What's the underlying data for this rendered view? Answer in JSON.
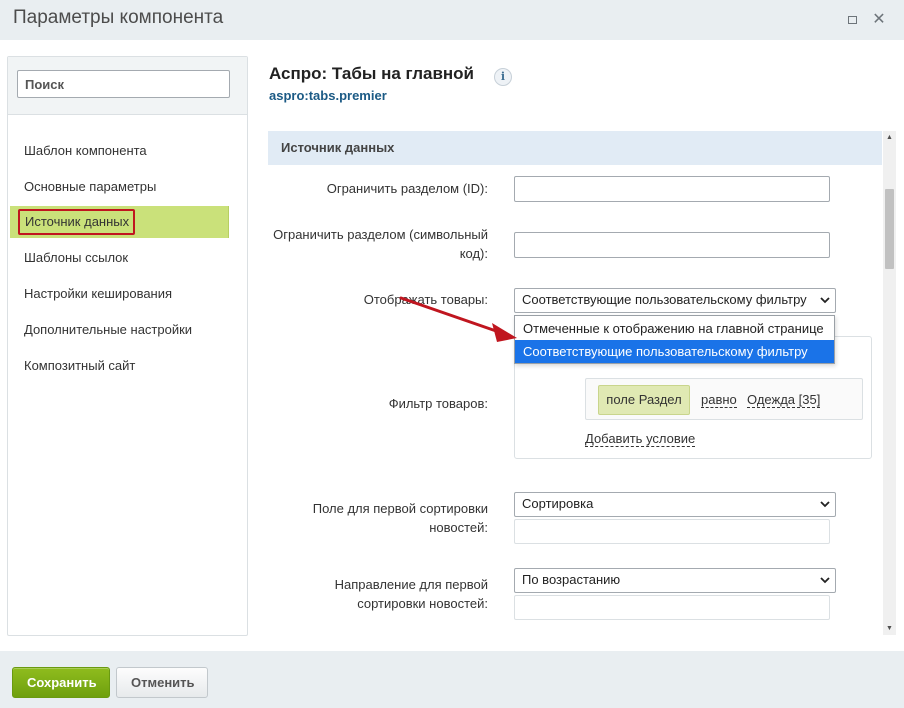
{
  "window": {
    "title": "Параметры компонента",
    "maximize_icon": "maximize-icon",
    "close_icon": "close-icon",
    "close_glyph": "✕"
  },
  "sidebar": {
    "search_placeholder": "Поиск",
    "items": [
      {
        "label": "Шаблон компонента",
        "active": false
      },
      {
        "label": "Основные параметры",
        "active": false
      },
      {
        "label": "Источник данных",
        "active": true
      },
      {
        "label": "Шаблоны ссылок",
        "active": false
      },
      {
        "label": "Настройки кеширования",
        "active": false
      },
      {
        "label": "Дополнительные настройки",
        "active": false
      },
      {
        "label": "Композитный сайт",
        "active": false
      }
    ]
  },
  "component": {
    "title": "Аспро: Табы на главной",
    "code": "aspro:tabs.premier",
    "info_glyph": "i"
  },
  "section": {
    "title": "Источник данных"
  },
  "fields": {
    "section_id_label": "Ограничить разделом (ID):",
    "section_id_value": "",
    "section_code_label": "Ограничить разделом (символьный код):",
    "section_code_value": "",
    "display_label": "Отображать товары:",
    "display_value": "Соответствующие пользовательскому фильтру",
    "display_options": [
      "Отмеченные к отображению на главной странице",
      "Соответствующие пользовательскому фильтру"
    ],
    "filter_label": "Фильтр товаров:",
    "filter_condition": {
      "field": "поле Раздел",
      "operator": "равно",
      "value": "Одежда [35]"
    },
    "add_condition": "Добавить условие",
    "sort1_label": "Поле для первой сортировки новостей:",
    "sort1_value": "Сортировка",
    "order1_label": "Направление для первой сортировки новостей:",
    "order1_value": "По возрастанию"
  },
  "footer": {
    "save": "Сохранить",
    "cancel": "Отменить"
  },
  "colors": {
    "active_nav": "#cae17a",
    "highlight_border": "#c0161f",
    "arrow": "#c0161f",
    "section_header": "#e1ebf5",
    "dropdown_selected": "#1a73e8",
    "save_button": "#7aab14"
  }
}
